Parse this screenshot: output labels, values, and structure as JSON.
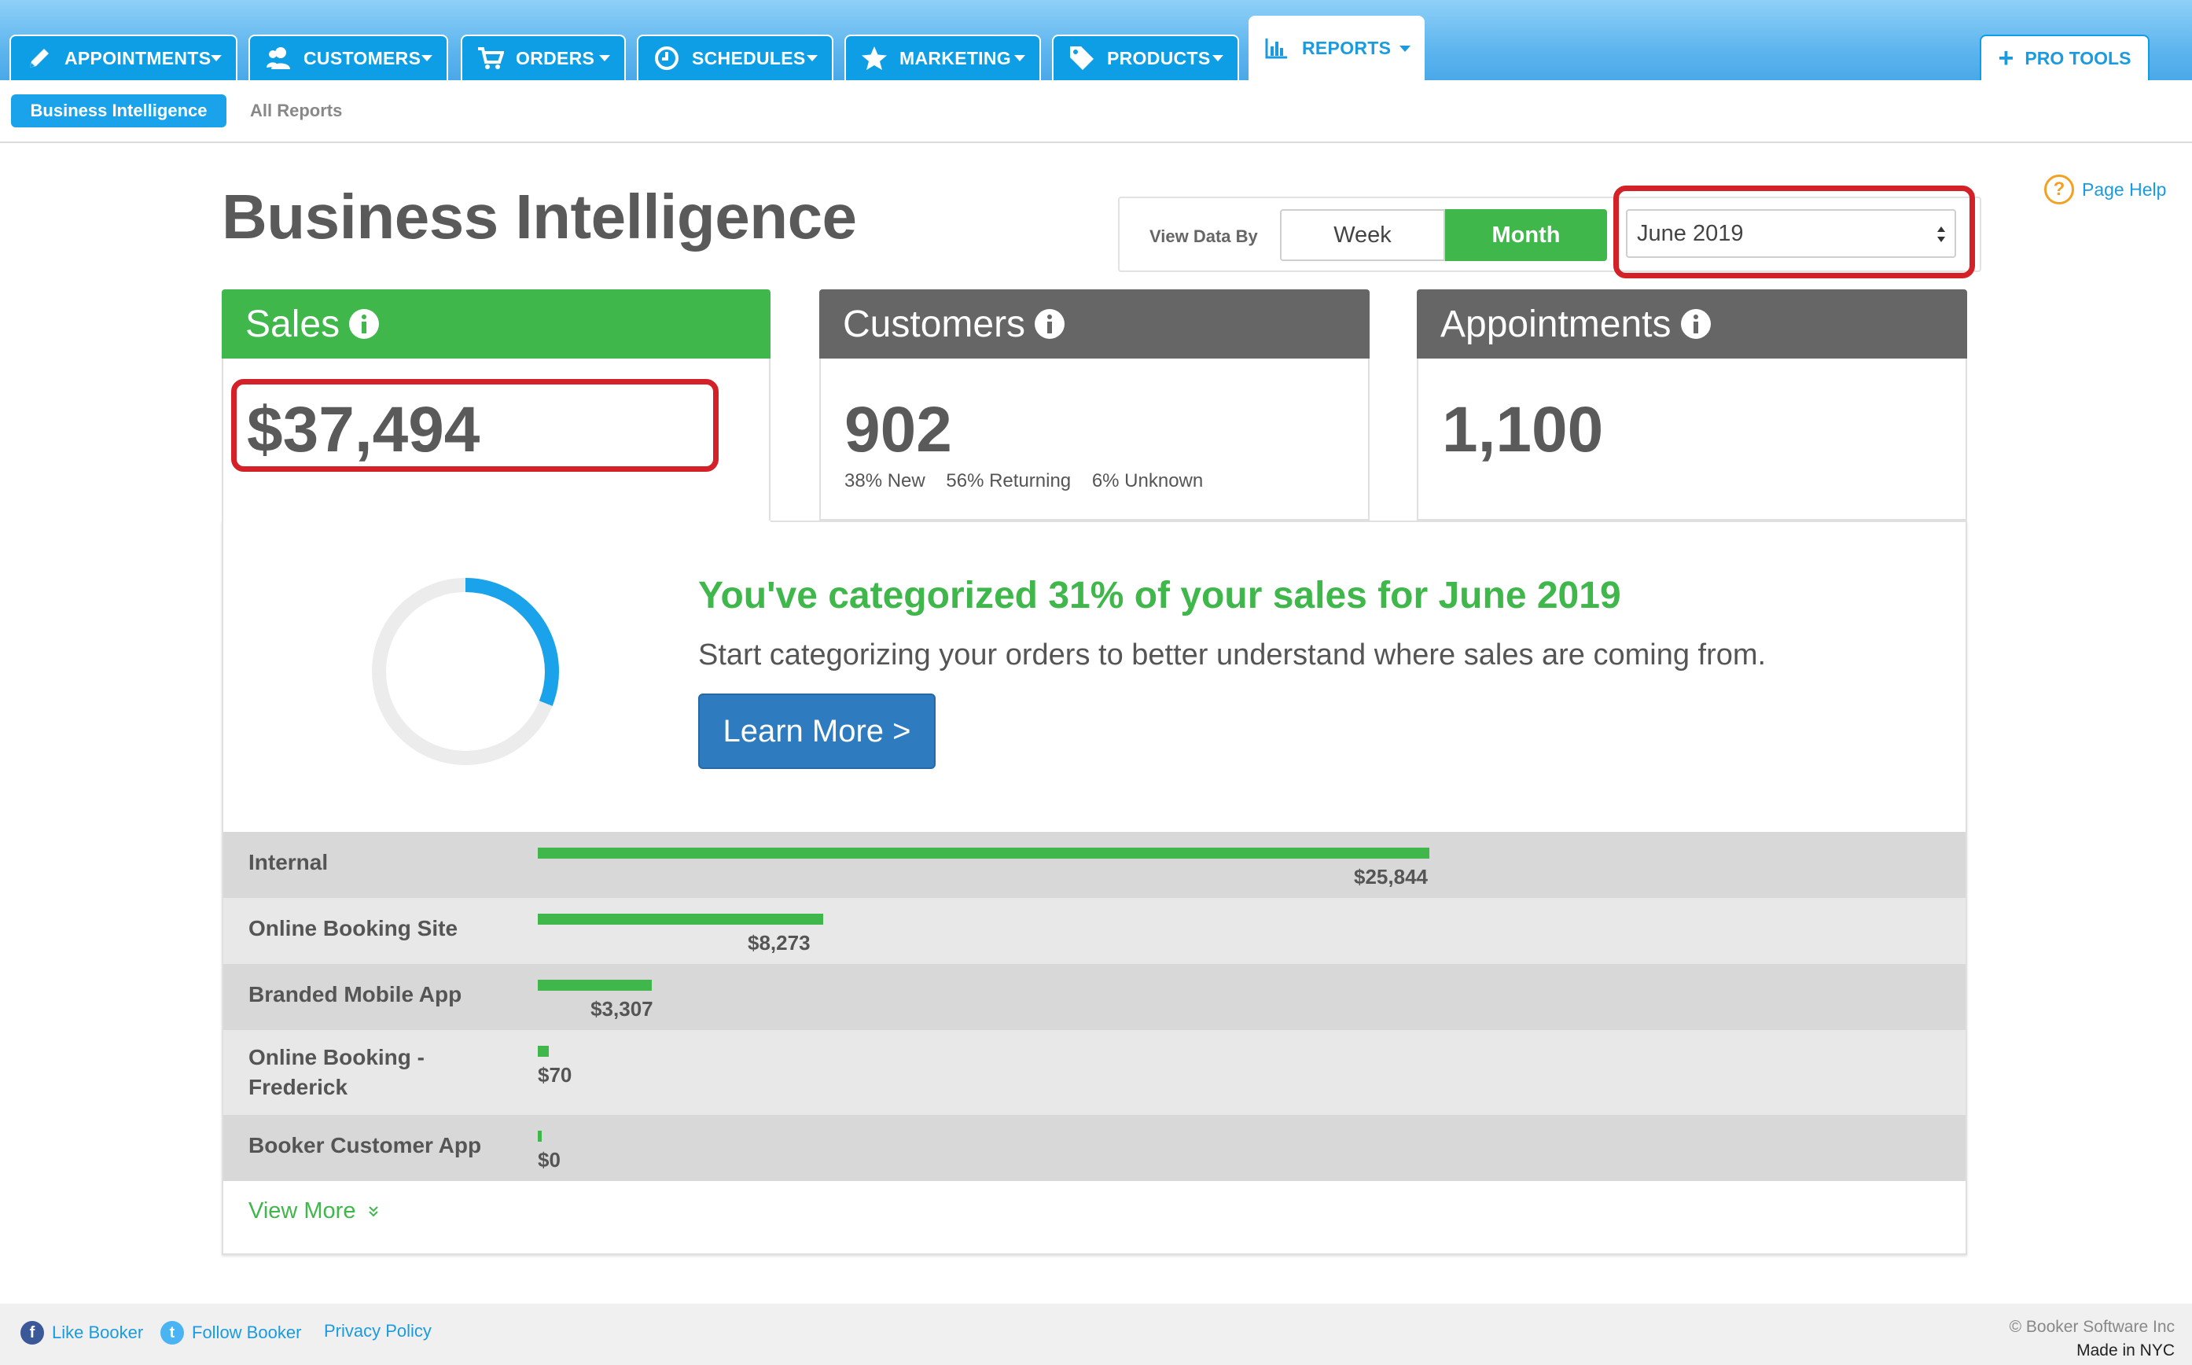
{
  "nav": {
    "tabs": [
      {
        "label": "APPOINTMENTS",
        "icon": "pencil-icon"
      },
      {
        "label": "CUSTOMERS",
        "icon": "people-icon"
      },
      {
        "label": "ORDERS",
        "icon": "cart-icon"
      },
      {
        "label": "SCHEDULES",
        "icon": "clock-icon"
      },
      {
        "label": "MARKETING",
        "icon": "star-icon"
      },
      {
        "label": "PRODUCTS",
        "icon": "tag-icon"
      },
      {
        "label": "REPORTS",
        "icon": "bar-chart-icon",
        "active": true
      }
    ],
    "pro_tools": "PRO TOOLS"
  },
  "subnav": {
    "active": "Business Intelligence",
    "other": "All Reports"
  },
  "page": {
    "title": "Business Intelligence",
    "view_data_by": "View Data By",
    "week": "Week",
    "month": "Month",
    "selected_period": "June 2019",
    "page_help": "Page Help"
  },
  "cards": {
    "sales": {
      "title": "Sales",
      "value": "$37,494"
    },
    "customers": {
      "title": "Customers",
      "value": "902",
      "new": "38% New",
      "returning": "56% Returning",
      "unknown": "6% Unknown"
    },
    "appointments": {
      "title": "Appointments",
      "value": "1,100"
    }
  },
  "categorize": {
    "headline": "You've categorized 31% of your sales for June 2019",
    "subtext": "Start categorizing your orders to better understand where sales are coming from.",
    "button": "Learn More >",
    "percent_categorized": 31
  },
  "sales_sources": [
    {
      "label": "Internal",
      "value": "$25,844",
      "amount": 25844
    },
    {
      "label": "Online Booking Site",
      "value": "$8,273",
      "amount": 8273
    },
    {
      "label": "Branded Mobile App",
      "value": "$3,307",
      "amount": 3307
    },
    {
      "label_lines": [
        "Online Booking -",
        "Frederick"
      ],
      "value": "$70",
      "amount": 70
    },
    {
      "label": "Booker Customer App",
      "value": "$0",
      "amount": 0
    }
  ],
  "view_more": "View More",
  "footer": {
    "like": "Like Booker",
    "follow": "Follow Booker",
    "privacy": "Privacy Policy",
    "copyright": "© Booker Software Inc",
    "made_in": "Made in NYC"
  },
  "colors": {
    "nav_blue": "#0e9ee6",
    "green": "#3fb74b",
    "card_gray": "#666666",
    "button_blue": "#2f7bc0",
    "highlight_red": "#d42027"
  }
}
